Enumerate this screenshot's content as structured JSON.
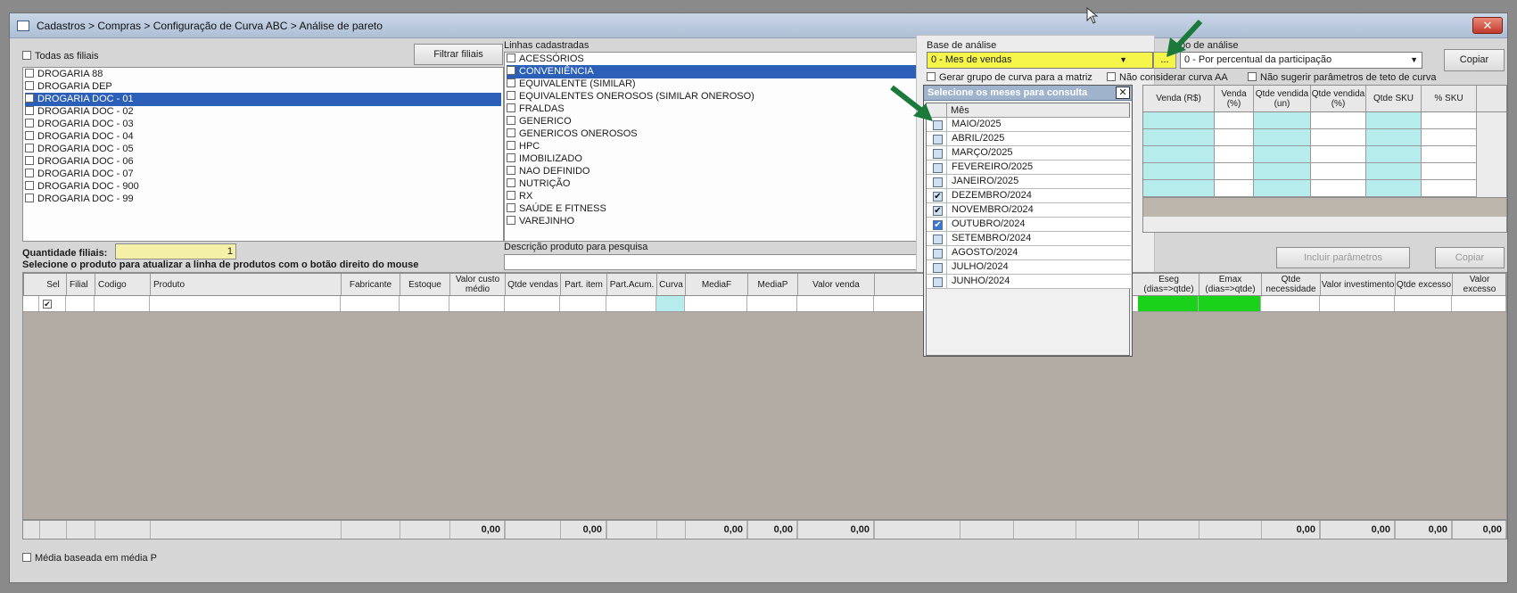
{
  "window": {
    "title": "Cadastros > Compras > Configuração de Curva ABC > Análise de pareto",
    "close_label": "✕"
  },
  "filiais": {
    "todas_label": "Todas as filiais",
    "filtrar_button": "Filtrar filiais",
    "items": [
      {
        "label": "DROGARIA 88",
        "checked": false,
        "selected": false
      },
      {
        "label": "DROGARIA DEP",
        "checked": false,
        "selected": false
      },
      {
        "label": "DROGARIA DOC - 01",
        "checked": true,
        "selected": true
      },
      {
        "label": "DROGARIA DOC - 02",
        "checked": false,
        "selected": false
      },
      {
        "label": "DROGARIA DOC - 03",
        "checked": false,
        "selected": false
      },
      {
        "label": "DROGARIA DOC - 04",
        "checked": false,
        "selected": false
      },
      {
        "label": "DROGARIA DOC - 05",
        "checked": false,
        "selected": false
      },
      {
        "label": "DROGARIA DOC - 06",
        "checked": false,
        "selected": false
      },
      {
        "label": "DROGARIA DOC - 07",
        "checked": false,
        "selected": false
      },
      {
        "label": "DROGARIA DOC - 900",
        "checked": false,
        "selected": false
      },
      {
        "label": "DROGARIA DOC - 99",
        "checked": false,
        "selected": false
      }
    ],
    "quantidade_label": "Quantidade filiais:",
    "quantidade_value": "1"
  },
  "linhas": {
    "label": "Linhas cadastradas",
    "items": [
      {
        "label": "ACESSÓRIOS",
        "checked": false,
        "selected": false
      },
      {
        "label": "CONVENIÊNCIA",
        "checked": true,
        "selected": true
      },
      {
        "label": "EQUIVALENTE (SIMILAR)",
        "checked": false,
        "selected": false
      },
      {
        "label": "EQUIVALENTES ONEROSOS (SIMILAR ONEROSO)",
        "checked": false,
        "selected": false
      },
      {
        "label": "FRALDAS",
        "checked": false,
        "selected": false
      },
      {
        "label": "GENERICO",
        "checked": false,
        "selected": false
      },
      {
        "label": "GENERICOS ONEROSOS",
        "checked": false,
        "selected": false
      },
      {
        "label": "HPC",
        "checked": false,
        "selected": false
      },
      {
        "label": "IMOBILIZADO",
        "checked": false,
        "selected": false
      },
      {
        "label": "NAO DEFINIDO",
        "checked": false,
        "selected": false
      },
      {
        "label": "NUTRIÇÃO",
        "checked": false,
        "selected": false
      },
      {
        "label": "RX",
        "checked": false,
        "selected": false
      },
      {
        "label": "SAÚDE E FITNESS",
        "checked": false,
        "selected": false
      },
      {
        "label": "VAREJINHO",
        "checked": false,
        "selected": false
      }
    ],
    "descricao_label": "Descrição produto para pesquisa"
  },
  "analise": {
    "base_label": "Base de análise",
    "base_value": "0 - Mes de vendas",
    "ellipsis_button": "...",
    "tipo_label": "po de análise",
    "tipo_value": "0 - Por percentual da participação",
    "copiar_button": "Copiar",
    "gerar_label": "Gerar grupo de curva para a matriz",
    "nao_considerar_label": "Não considerar curva AA",
    "nao_sugerir_label": "Não sugerir parâmetros de teto de curva",
    "incluir_button": "Incluir parâmetros",
    "copiar2_button": "Copiar"
  },
  "curve_grid": {
    "headers": [
      "Venda (R$)",
      "Venda (%)",
      "Qtde vendida (un)",
      "Qtde vendida (%)",
      "Qtde SKU",
      "% SKU"
    ]
  },
  "instruction": "Selecione o produto para atualizar a linha de produtos com o botão direito do mouse",
  "product_grid": {
    "headers": [
      "Sel",
      "Filial",
      "Codigo",
      "Produto",
      "Fabricante",
      "Estoque",
      "Valor custo médio",
      "Qtde vendas",
      "Part. item",
      "Part.Acum.",
      "Curva",
      "MediaF",
      "MediaP",
      "Valor venda"
    ],
    "right_headers": [
      "Eseg (dias=>qtde)",
      "Emax (dias=>qtde)",
      "Qtde necessidade",
      "Valor investimento",
      "Qtde excesso",
      "Valor excesso"
    ],
    "totals": {
      "qtde_vendas": "0,00",
      "part_acum": "0,00",
      "mediaf": "0,00",
      "mediap": "0,00",
      "valor_venda": "0,00",
      "qtde_necessidade": "0,00",
      "valor_investimento": "0,00",
      "qtde_excesso": "0,00",
      "valor_excesso": "0,00"
    }
  },
  "media_label": "Média baseada em média P",
  "popup": {
    "title": "Selecione os meses para consulta",
    "column_header": "Mês",
    "months": [
      {
        "label": "MAIO/2025",
        "checked": false
      },
      {
        "label": "ABRIL/2025",
        "checked": false
      },
      {
        "label": "MARÇO/2025",
        "checked": false
      },
      {
        "label": "FEVEREIRO/2025",
        "checked": false
      },
      {
        "label": "JANEIRO/2025",
        "checked": false
      },
      {
        "label": "DEZEMBRO/2024",
        "checked": true
      },
      {
        "label": "NOVEMBRO/2024",
        "checked": true
      },
      {
        "label": "OUTUBRO/2024",
        "checked": true
      },
      {
        "label": "SETEMBRO/2024",
        "checked": false
      },
      {
        "label": "AGOSTO/2024",
        "checked": false
      },
      {
        "label": "JULHO/2024",
        "checked": false
      },
      {
        "label": "JUNHO/2024",
        "checked": false
      }
    ]
  },
  "colors": {
    "selection": "#2b5fb8",
    "highlight_yellow": "#f6f64a",
    "cyan_cell": "#b7ecec",
    "green_cell": "#19d219",
    "arrow_green": "#1b7a3b"
  }
}
